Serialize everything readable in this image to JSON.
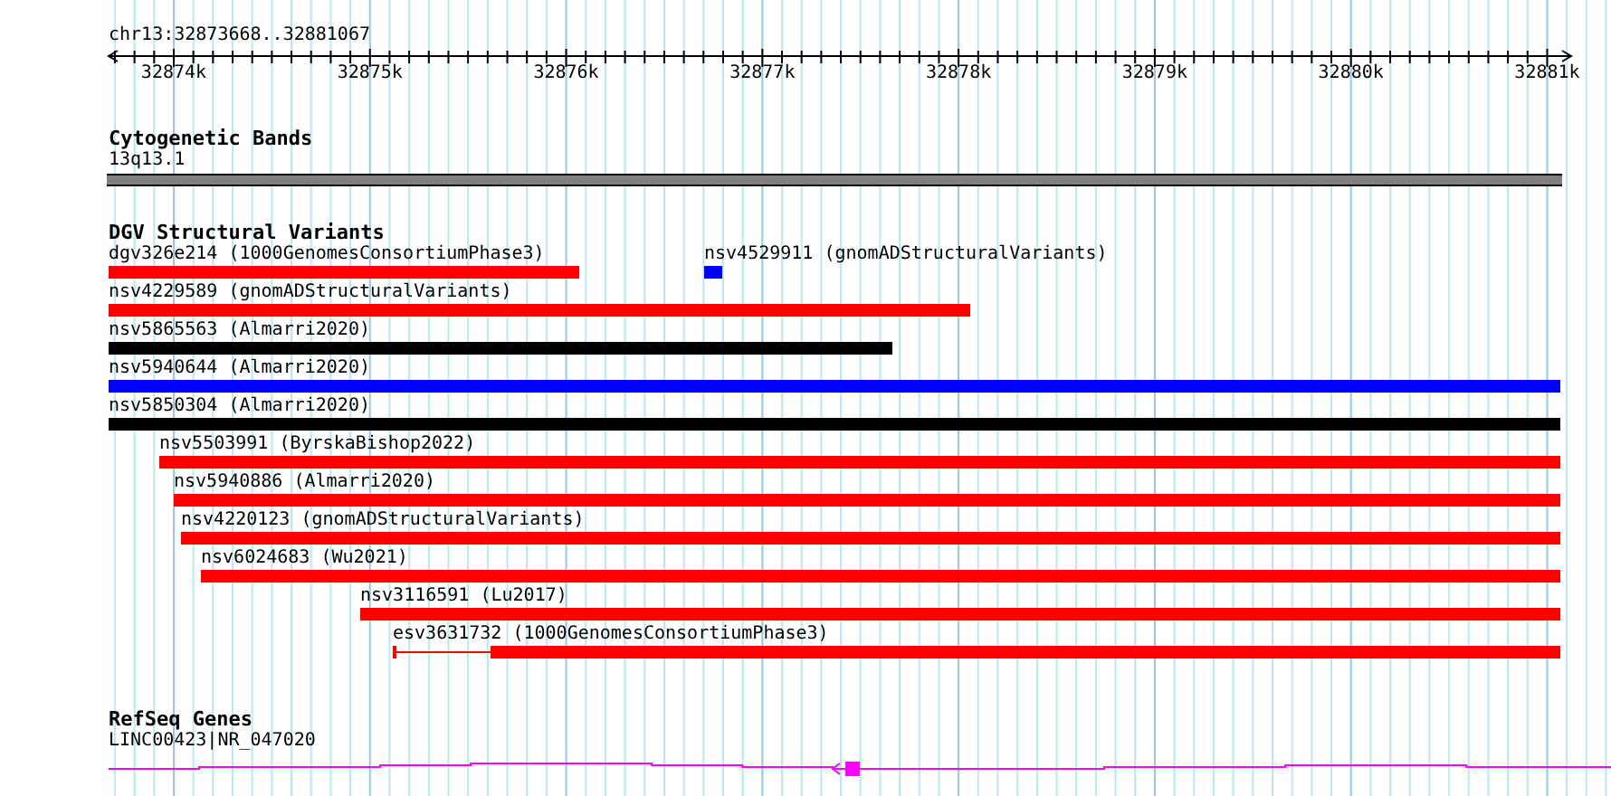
{
  "ruler": {
    "locus": "chr13:32873668..32881067",
    "ticks": [
      "32874k",
      "32875k",
      "32876k",
      "32877k",
      "32878k",
      "32879k",
      "32880k",
      "32881k"
    ]
  },
  "cytogenetic_bands": {
    "title": "Cytogenetic Bands",
    "band_label": "13q13.1"
  },
  "dgv_structural_variants": {
    "title": "DGV Structural Variants",
    "rows": [
      [
        {
          "label": "dgv326e214 (1000GenomesConsortiumPhase3)",
          "color": "#ff0000",
          "kind": "bar"
        },
        {
          "label": "nsv4529911 (gnomADStructuralVariants)",
          "color": "#0000ff",
          "kind": "bar"
        }
      ],
      [
        {
          "label": "nsv4229589 (gnomADStructuralVariants)",
          "color": "#ff0000",
          "kind": "bar"
        }
      ],
      [
        {
          "label": "nsv5865563 (Almarri2020)",
          "color": "#000000",
          "kind": "bar"
        }
      ],
      [
        {
          "label": "nsv5940644 (Almarri2020)",
          "color": "#0000ff",
          "kind": "bar"
        }
      ],
      [
        {
          "label": "nsv5850304 (Almarri2020)",
          "color": "#000000",
          "kind": "bar"
        }
      ],
      [
        {
          "label": "nsv5503991 (ByrskaBishop2022)",
          "color": "#ff0000",
          "kind": "bar"
        }
      ],
      [
        {
          "label": "nsv5940886 (Almarri2020)",
          "color": "#ff0000",
          "kind": "bar"
        }
      ],
      [
        {
          "label": "nsv4220123 (gnomADStructuralVariants)",
          "color": "#ff0000",
          "kind": "bar"
        }
      ],
      [
        {
          "label": "nsv6024683 (Wu2021)",
          "color": "#ff0000",
          "kind": "bar"
        }
      ],
      [
        {
          "label": "nsv3116591 (Lu2017)",
          "color": "#ff0000",
          "kind": "bar"
        }
      ],
      [
        {
          "label": "esv3631732 (1000GenomesConsortiumPhase3)",
          "color": "#ff0000",
          "kind": "gapped"
        }
      ]
    ]
  },
  "refseq_genes": {
    "title": "RefSeq Genes",
    "genes": [
      {
        "label": "LINC00423|NR_047020"
      }
    ]
  }
}
